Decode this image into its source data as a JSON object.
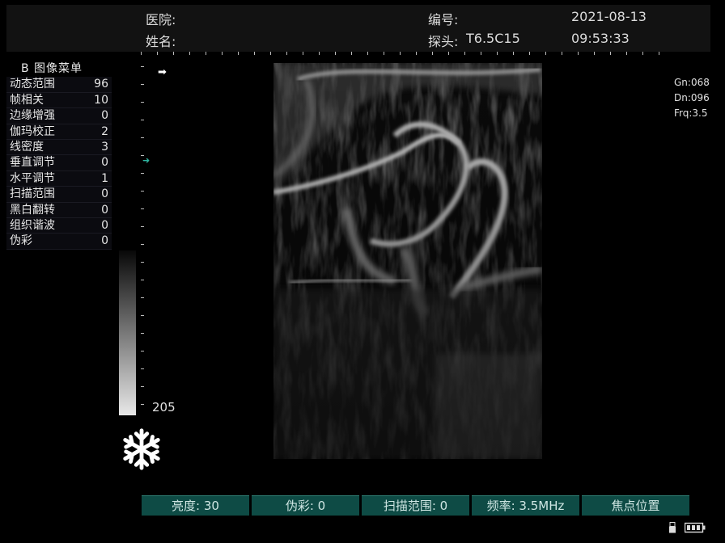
{
  "header": {
    "hospital_label": "医院:",
    "name_label": "姓名:",
    "number_label": "编号:",
    "probe_label": "探头:",
    "probe_value": "T6.5C15",
    "date": "2021-08-13",
    "time": "09:53:33"
  },
  "menu": {
    "title": "B 图像菜单",
    "items": [
      {
        "label": "动态范围",
        "value": "96"
      },
      {
        "label": "帧相关",
        "value": "10"
      },
      {
        "label": "边缘增强",
        "value": "0"
      },
      {
        "label": "伽玛校正",
        "value": "2"
      },
      {
        "label": "线密度",
        "value": "3"
      },
      {
        "label": "垂直调节",
        "value": "0"
      },
      {
        "label": "水平调节",
        "value": "1"
      },
      {
        "label": "扫描范围",
        "value": "0"
      },
      {
        "label": "黑白翻转",
        "value": "0"
      },
      {
        "label": "组织谐波",
        "value": "0"
      },
      {
        "label": "伪彩",
        "value": "0"
      }
    ]
  },
  "grayscale": {
    "max_value": "205"
  },
  "params": {
    "gain": "Gn:068",
    "dynamic": "Dn:096",
    "frequency": "Frq:3.5"
  },
  "bottom_buttons": [
    {
      "label": "亮度: 30"
    },
    {
      "label": "伪彩: 0"
    },
    {
      "label": "扫描范围: 0"
    },
    {
      "label": "频率: 3.5MHz"
    },
    {
      "label": "焦点位置"
    }
  ],
  "icons": {
    "freeze": "snowflake-icon",
    "usb": "usb-icon",
    "battery": "battery-icon",
    "focus": "focus-marker-icon",
    "direction": "direction-arrow-icon"
  },
  "colors": {
    "button_bg": "#0e4b45",
    "focus_marker": "#2fb5a0",
    "header_bg": "#121212"
  }
}
